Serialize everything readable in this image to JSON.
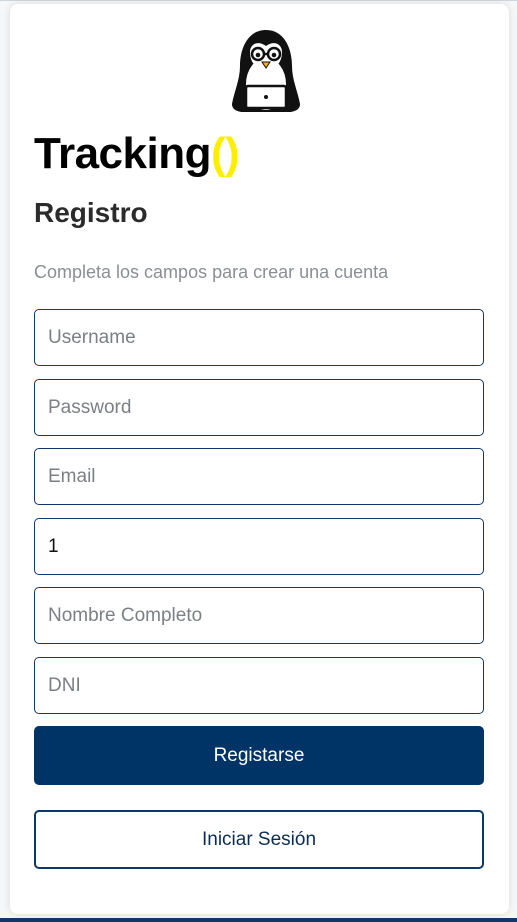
{
  "brand": {
    "name": "Tracking",
    "parens": "()"
  },
  "form": {
    "title": "Registro",
    "subtitle": "Completa los campos para crear una cuenta",
    "fields": [
      {
        "placeholder": "Username",
        "value": ""
      },
      {
        "placeholder": "Password",
        "value": ""
      },
      {
        "placeholder": "Email",
        "value": ""
      },
      {
        "placeholder": "",
        "value": "1"
      },
      {
        "placeholder": "Nombre Completo",
        "value": ""
      },
      {
        "placeholder": "DNI",
        "value": ""
      }
    ]
  },
  "buttons": {
    "register_label": "Registarse",
    "login_label": "Iniciar Sesión"
  },
  "logo": {
    "icon": "penguin-laptop-icon"
  },
  "colors": {
    "primary": "#003366",
    "accent": "#ffee00",
    "field_border": "#123a66"
  }
}
